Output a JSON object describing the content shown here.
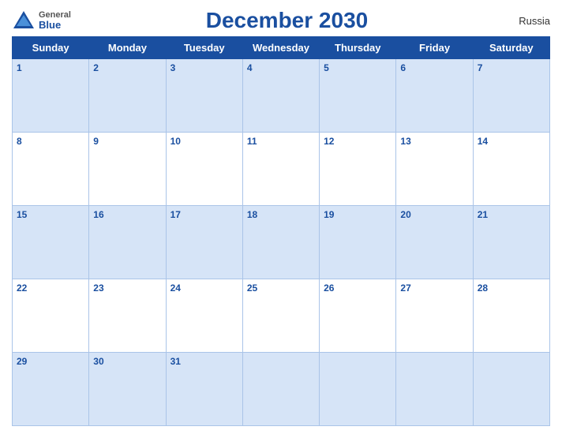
{
  "header": {
    "title": "December 2030",
    "country": "Russia",
    "logo": {
      "general": "General",
      "blue": "Blue"
    }
  },
  "days_of_week": [
    "Sunday",
    "Monday",
    "Tuesday",
    "Wednesday",
    "Thursday",
    "Friday",
    "Saturday"
  ],
  "weeks": [
    [
      1,
      2,
      3,
      4,
      5,
      6,
      7
    ],
    [
      8,
      9,
      10,
      11,
      12,
      13,
      14
    ],
    [
      15,
      16,
      17,
      18,
      19,
      20,
      21
    ],
    [
      22,
      23,
      24,
      25,
      26,
      27,
      28
    ],
    [
      29,
      30,
      31,
      null,
      null,
      null,
      null
    ]
  ]
}
